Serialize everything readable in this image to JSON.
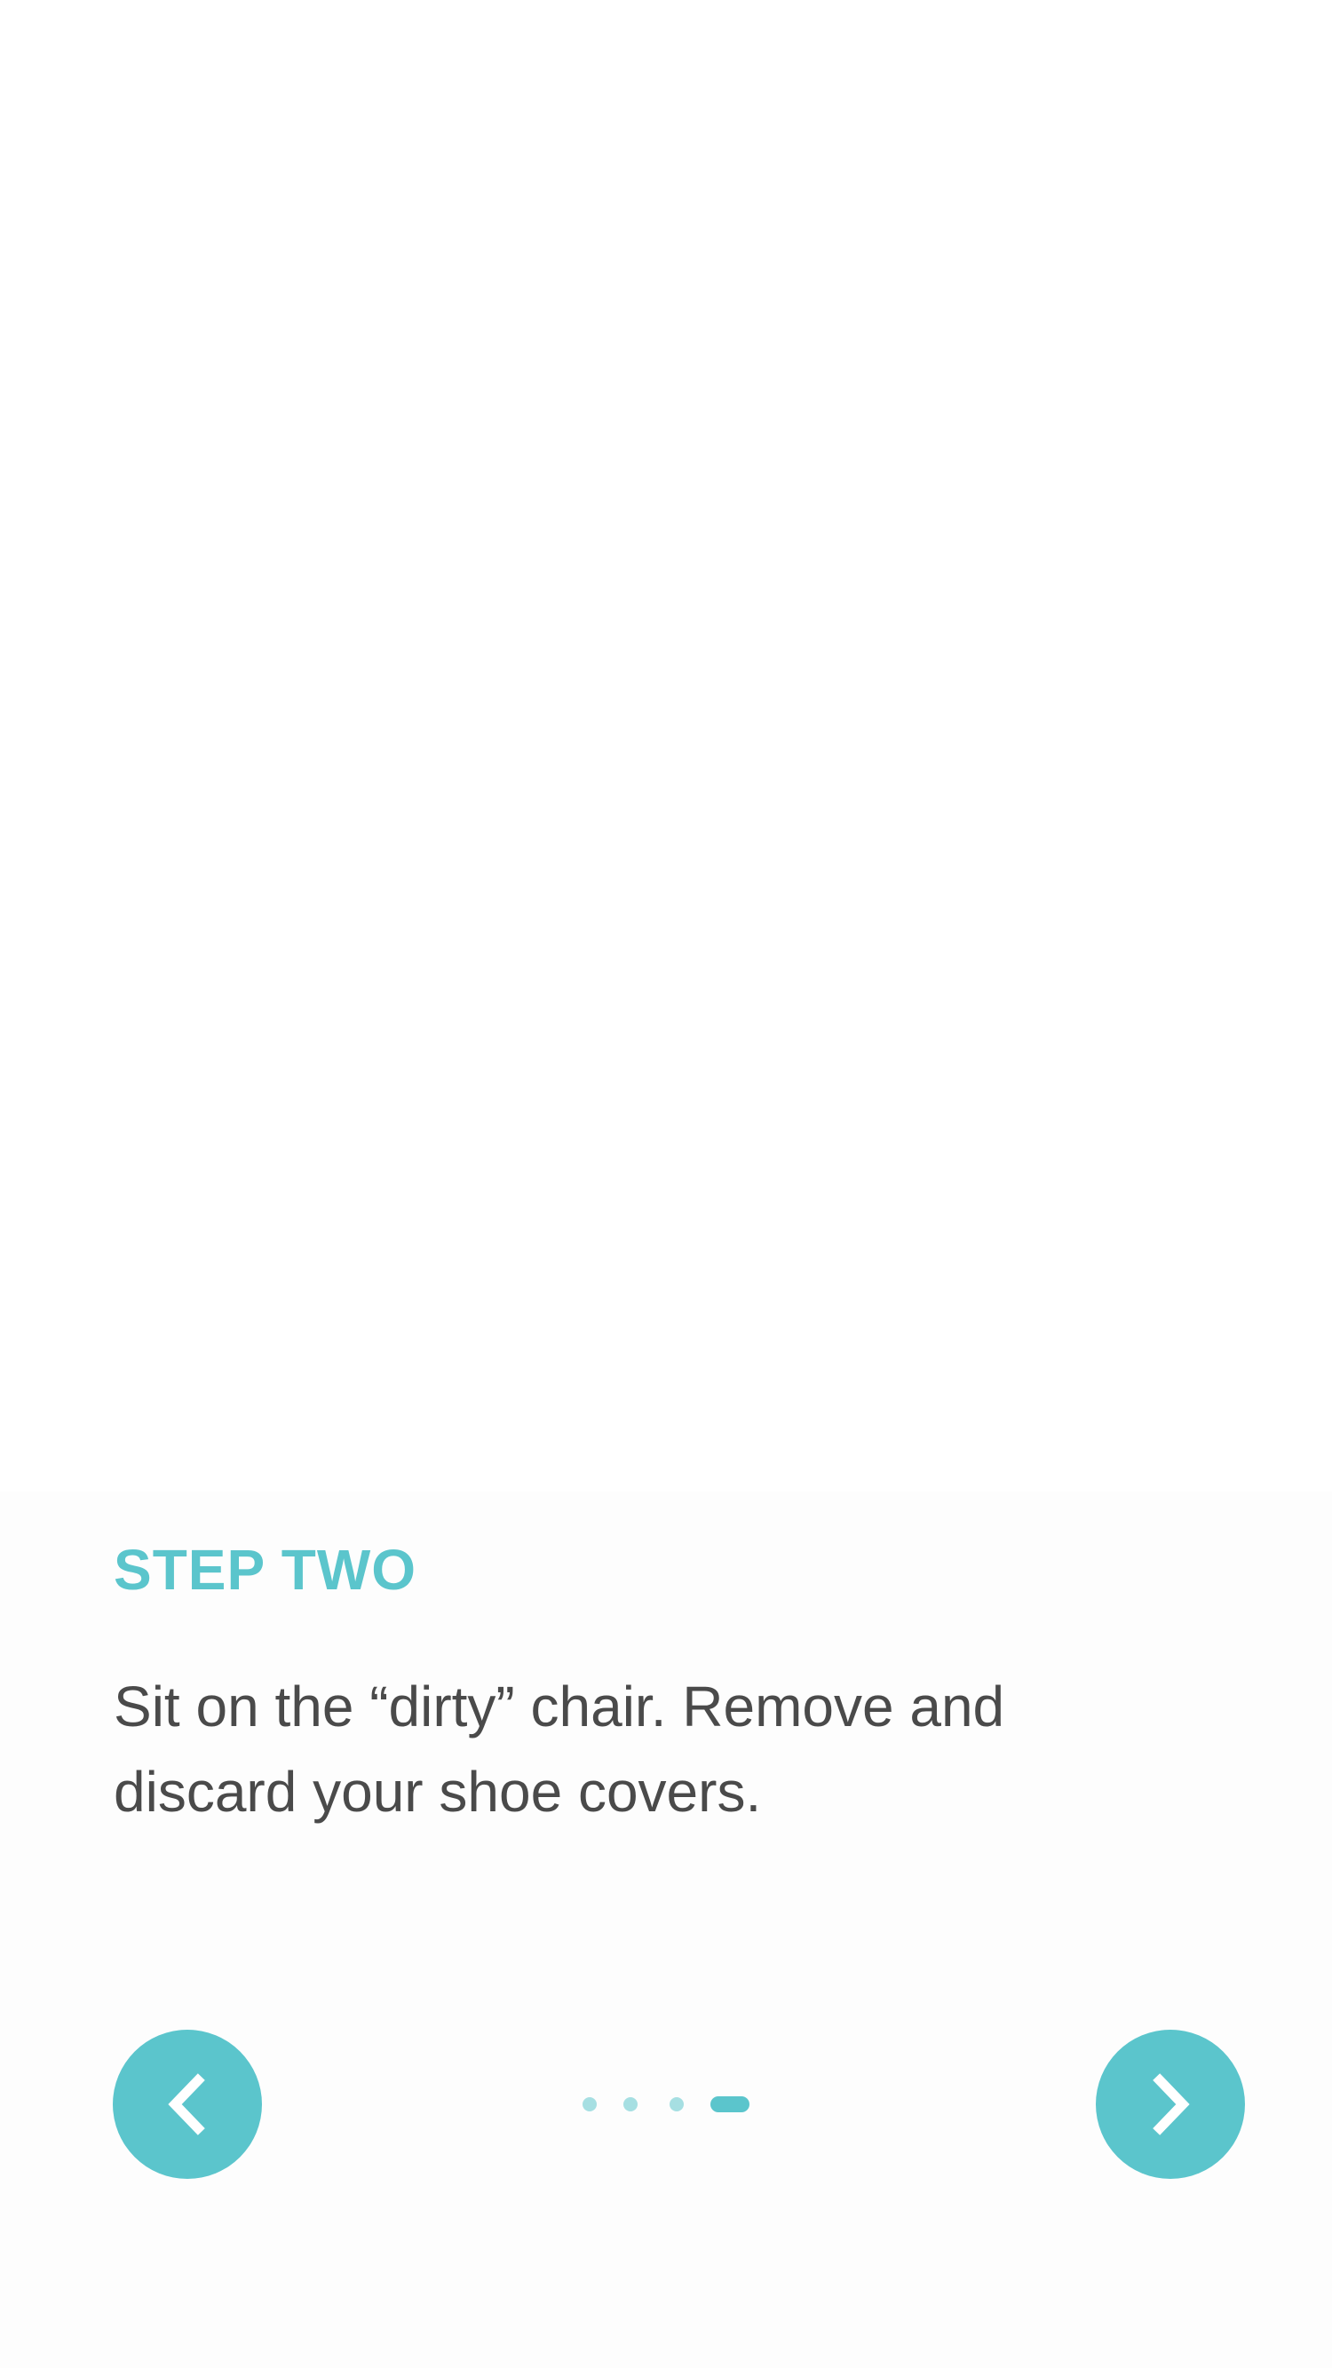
{
  "step": {
    "title": "STEP TWO",
    "description": "Sit on the “dirty” chair. Remove and discard your shoe covers."
  },
  "navigation": {
    "prev_icon": "chevron-left-icon",
    "next_icon": "chevron-right-icon"
  },
  "pager": {
    "total": 4,
    "current": 4
  },
  "colors": {
    "accent": "#5bc5cc",
    "accent_light": "#a6dfe2",
    "body_text": "#4a4a4a",
    "background": "#fdfdfd"
  }
}
